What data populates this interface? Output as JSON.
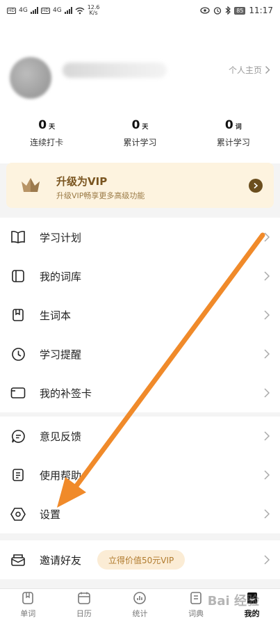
{
  "status_bar": {
    "left_tags": [
      "HD",
      "4G",
      "HD",
      "4G"
    ],
    "speed_value": "12.6",
    "speed_unit": "K/s",
    "battery": "85",
    "time": "11:17"
  },
  "profile": {
    "home_link": "个人主页"
  },
  "stats": [
    {
      "value": "0",
      "unit": "天",
      "label": "连续打卡"
    },
    {
      "value": "0",
      "unit": "天",
      "label": "累计学习"
    },
    {
      "value": "0",
      "unit": "词",
      "label": "累计学习"
    }
  ],
  "vip": {
    "title": "升级为VIP",
    "subtitle": "升级VIP畅享更多高级功能"
  },
  "menu_group_1": [
    {
      "label": "学习计划",
      "icon": "book-icon"
    },
    {
      "label": "我的词库",
      "icon": "library-icon"
    },
    {
      "label": "生词本",
      "icon": "bookmark-icon"
    },
    {
      "label": "学习提醒",
      "icon": "clock-icon"
    },
    {
      "label": "我的补签卡",
      "icon": "card-icon"
    }
  ],
  "menu_group_2": [
    {
      "label": "意见反馈",
      "icon": "feedback-icon"
    },
    {
      "label": "使用帮助",
      "icon": "help-icon"
    },
    {
      "label": "设置",
      "icon": "gear-icon"
    }
  ],
  "invite": {
    "label": "邀请好友",
    "badge": "立得价值50元VIP"
  },
  "tabs": [
    {
      "label": "单词",
      "icon": "word-icon"
    },
    {
      "label": "日历",
      "icon": "calendar-icon"
    },
    {
      "label": "统计",
      "icon": "stats-icon"
    },
    {
      "label": "词典",
      "icon": "dictionary-icon"
    },
    {
      "label": "我的",
      "icon": "profile-icon",
      "active": true
    }
  ],
  "watermark": "Bai 经验",
  "colors": {
    "accent_arrow": "#f08a2a",
    "vip_bg": "#fdf3df",
    "vip_text": "#7a5520"
  }
}
